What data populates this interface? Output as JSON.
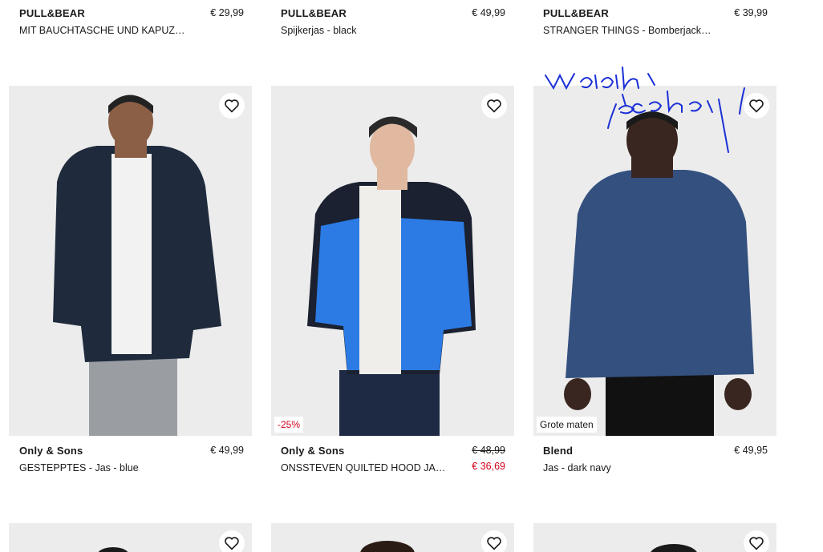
{
  "top_row": [
    {
      "brand": "PULL&BEAR",
      "name": "MIT BAUCHTASCHE UND KAPUZE...",
      "price": "€ 29,99"
    },
    {
      "brand": "PULL&BEAR",
      "name": "Spijkerjas - black",
      "price": "€ 49,99"
    },
    {
      "brand": "PULL&BEAR",
      "name": "STRANGER THINGS - Bomberjacks...",
      "price": "€ 39,99"
    }
  ],
  "middle_row": [
    {
      "brand": "Only & Sons",
      "name": "GESTEPPTES - Jas - blue",
      "price": "€ 49,99",
      "badge": ""
    },
    {
      "brand": "Only & Sons",
      "name": "ONSSTEVEN QUILTED HOOD JAC...",
      "price_original": "€ 48,99",
      "price_sale": "€ 36,69",
      "badge": "-25%"
    },
    {
      "brand": "Blend",
      "name": "Jas - dark navy",
      "price": "€ 49,95",
      "badge": "Grote maten"
    }
  ],
  "icons": {
    "favorite": "heart-outline-icon"
  },
  "colors": {
    "sale": "#d0021b",
    "image_bg": "#efefef"
  }
}
